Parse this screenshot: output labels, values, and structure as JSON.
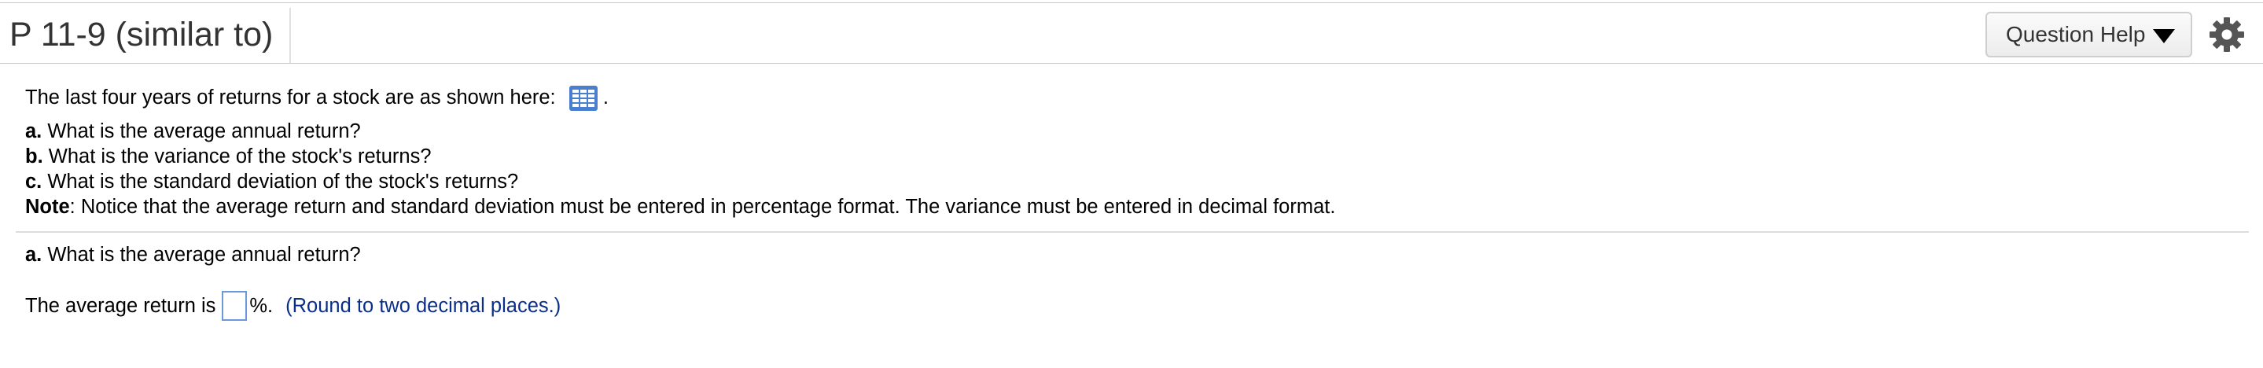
{
  "header": {
    "title": "P 11-9 (similar to)",
    "help_button_label": "Question Help",
    "caret_icon": "caret-down-icon",
    "settings_icon": "gear-icon"
  },
  "problem": {
    "intro_text": "The last four years of returns for a stock are as shown here:",
    "intro_end": ".",
    "data_icon": "table-grid-icon",
    "items": [
      {
        "letter": "a.",
        "text": " What is the average annual return?"
      },
      {
        "letter": "b.",
        "text": " What is the variance of the stock's returns?"
      },
      {
        "letter": "c.",
        "text": " What is the standard deviation of the stock's returns?"
      }
    ],
    "note_label": "Note",
    "note_text": ": Notice that the average return and standard deviation must be entered in percentage format. The variance must be entered in decimal format."
  },
  "question": {
    "letter": "a.",
    "text": " What is the average annual return?",
    "answer_prefix": "The average return is",
    "answer_value": "",
    "answer_suffix": "%.",
    "round_note": "(Round to two decimal places.)"
  },
  "colors": {
    "icon_blue": "#4a7fd0",
    "note_blue": "#0a2f8a",
    "input_border": "#6a9bd8"
  }
}
